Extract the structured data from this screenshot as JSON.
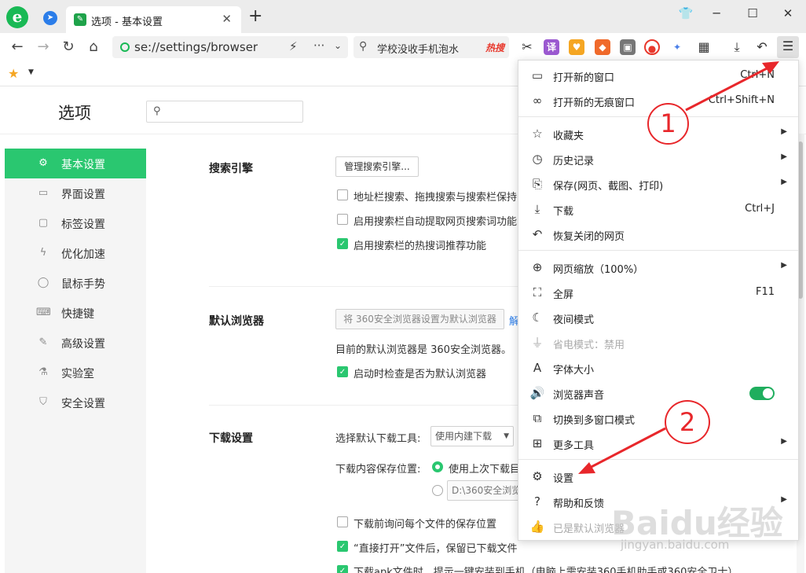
{
  "titlebar": {
    "tab_title": "选项 - 基本设置",
    "tab_close": "✕",
    "new_tab": "+",
    "logo": "e"
  },
  "toolbar": {
    "address": "se://settings/browser",
    "search_text": "学校没收手机泡水",
    "search_hot": "热搜",
    "ext_translate": "译"
  },
  "settings": {
    "title": "选项",
    "sidebar": [
      {
        "label": "基本设置",
        "icon": "gear-icon"
      },
      {
        "label": "界面设置",
        "icon": "window-icon"
      },
      {
        "label": "标签设置",
        "icon": "tab-icon"
      },
      {
        "label": "优化加速",
        "icon": "bolt-icon"
      },
      {
        "label": "鼠标手势",
        "icon": "mouse-icon"
      },
      {
        "label": "快捷键",
        "icon": "keyboard-icon"
      },
      {
        "label": "高级设置",
        "icon": "wrench-icon"
      },
      {
        "label": "实验室",
        "icon": "flask-icon"
      },
      {
        "label": "安全设置",
        "icon": "shield-icon"
      }
    ],
    "search_engine": {
      "title": "搜索引擎",
      "manage_button": "管理搜索引擎...",
      "opt1": "地址栏搜索、拖拽搜索与搜索栏保持",
      "opt2": "启用搜索栏自动提取网页搜索词功能",
      "opt3": "启用搜索栏的热搜词推荐功能"
    },
    "default_browser": {
      "title": "默认浏览器",
      "set_button": "将 360安全浏览器设置为默认浏览器",
      "link": "解",
      "status": "目前的默认浏览器是 360安全浏览器。",
      "opt": "启动时检查是否为默认浏览器"
    },
    "download": {
      "title": "下载设置",
      "tool_label": "选择默认下载工具:",
      "tool_value": "使用内建下载",
      "location_label": "下载内容保存位置:",
      "location_opt": "使用上次下载目",
      "path": "D:\\360安全浏览",
      "ask_each": "下载前询问每个文件的保存位置",
      "keep_after_open": "“直接打开”文件后，保留已下载文件",
      "apk_install": "下载apk文件时，提示一键安装到手机（电脑上需安装360手机助手或360安全卫士）"
    }
  },
  "menu": {
    "items": [
      {
        "label": "打开新的窗口",
        "shortcut": "Ctrl+N"
      },
      {
        "label": "打开新的无痕窗口",
        "shortcut": "Ctrl+Shift+N"
      },
      {
        "label": "收藏夹"
      },
      {
        "label": "历史记录"
      },
      {
        "label": "保存(网页、截图、打印)"
      },
      {
        "label": "下载",
        "shortcut": "Ctrl+J"
      },
      {
        "label": "恢复关闭的网页"
      },
      {
        "label": "网页缩放（100%）"
      },
      {
        "label": "全屏",
        "shortcut": "F11"
      },
      {
        "label": "夜间模式"
      },
      {
        "label": "省电模式：禁用"
      },
      {
        "label": "字体大小"
      },
      {
        "label": "浏览器声音"
      },
      {
        "label": "切换到多窗口模式"
      },
      {
        "label": "更多工具"
      },
      {
        "label": "设置"
      },
      {
        "label": "帮助和反馈"
      },
      {
        "label": "已是默认浏览器"
      }
    ],
    "sound_enabled": true
  },
  "annotations": {
    "one": "1",
    "two": "2",
    "color": "#e8272b"
  },
  "watermark": {
    "main": "Baidu经验",
    "sub": "jingyan.baidu.com"
  },
  "colors": {
    "accent": "#2ac770",
    "toggle": "#1fae5e",
    "hot": "#e8382c"
  }
}
